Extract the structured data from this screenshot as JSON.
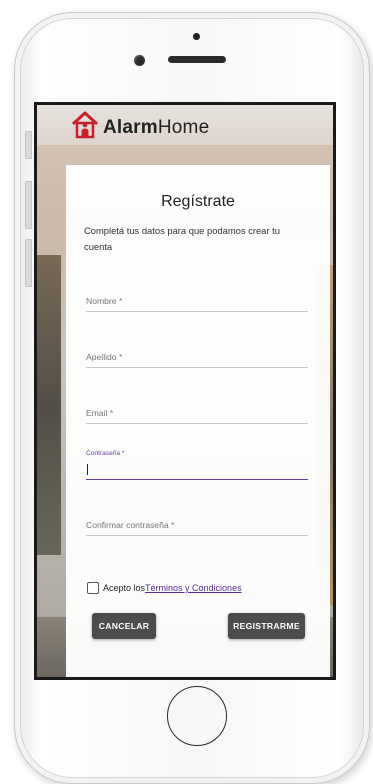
{
  "app": {
    "brand_bold": "Alarm",
    "brand_regular": "Home"
  },
  "form": {
    "title": "Regístrate",
    "subtitle": "Completá tus datos para que podamos crear tu cuenta",
    "fields": {
      "name": {
        "label": "Nombre *",
        "value": ""
      },
      "lastname": {
        "label": "Apellido *",
        "value": ""
      },
      "email": {
        "label": "Email *",
        "value": ""
      },
      "password": {
        "label": "Contraseña *",
        "value": ""
      },
      "confirm": {
        "label": "Confirmar contraseña *",
        "value": ""
      }
    },
    "terms": {
      "prefix": "Acepto los",
      "link": "Términos y Condiciones",
      "checked": false
    },
    "buttons": {
      "cancel": "CANCELAR",
      "register": "REGISTRARME"
    }
  },
  "colors": {
    "accent": "#6a3ea1",
    "button": "#4a4c4e",
    "logo_red": "#c8202a"
  },
  "icons": {
    "logo": "house-person-icon"
  }
}
